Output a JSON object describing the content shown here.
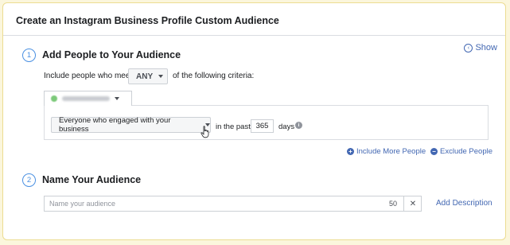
{
  "card": {
    "title": "Create an Instagram Business Profile Custom Audience",
    "show_label": "Show"
  },
  "section1": {
    "number": "1",
    "title": "Add People to Your Audience",
    "include_prefix": "Include people who meet",
    "match_value": "ANY",
    "include_suffix": "of the following criteria:",
    "engagement_value": "Everyone who engaged with your business",
    "in_the_past": "in the past",
    "days_value": "365",
    "days_label": "days",
    "include_more": "Include More People",
    "exclude": "Exclude People"
  },
  "section2": {
    "number": "2",
    "title": "Name Your Audience",
    "name_placeholder": "Name your audience",
    "char_limit": "50",
    "clear_glyph": "✕",
    "add_description": "Add Description"
  },
  "icons": {
    "show": "chevron-left-circle-icon",
    "info": "info-icon",
    "plus": "plus-circle-icon",
    "minus": "minus-circle-icon",
    "clear": "close-icon",
    "cursor": "hand-pointer-icon"
  },
  "colors": {
    "link": "#4267b2",
    "step_circle": "#4a90e2",
    "page_background": "#fbf6dc"
  }
}
